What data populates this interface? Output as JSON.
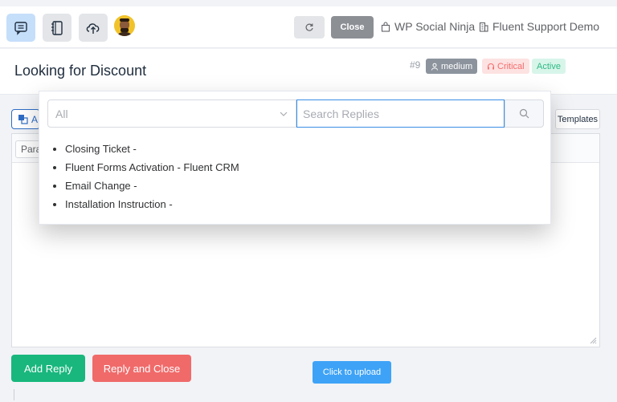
{
  "header": {
    "close_label": "Close",
    "links": [
      {
        "label": "WP Social Ninja",
        "icon": "bag-icon"
      },
      {
        "label": "Fluent Support Demo",
        "icon": "building-icon"
      }
    ],
    "icons": [
      "chat-icon",
      "notebook-icon",
      "cloud-upload-icon",
      "refresh-icon"
    ]
  },
  "ticket": {
    "title": "Looking for Discount",
    "number": "#9",
    "priority": "medium",
    "critical": "Critical",
    "status": "Active"
  },
  "editor": {
    "format_value": "Para",
    "ai_label": "A",
    "templates_label": "Templates"
  },
  "dropdown": {
    "filter_value": "All",
    "search_placeholder": "Search Replies",
    "items": [
      "Closing Ticket -",
      "Fluent Forms Activation - Fluent CRM",
      "Email Change -",
      "Installation Instruction -"
    ]
  },
  "actions": {
    "add_reply": "Add Reply",
    "reply_close": "Reply and Close",
    "upload": "Click to upload"
  },
  "colors": {
    "accent_blue": "#3a8ee6",
    "add_green": "#19b77e",
    "close_red": "#f06a6a",
    "upload_blue": "#3ea3f7"
  }
}
